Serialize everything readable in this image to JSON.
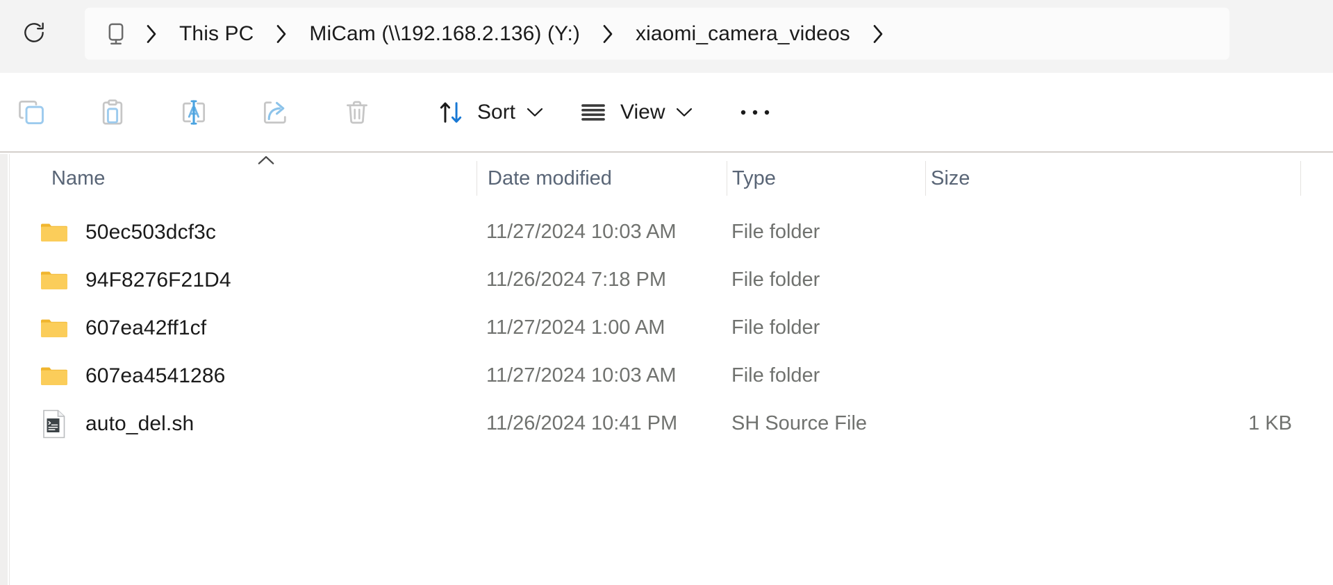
{
  "window": {
    "app": "File Explorer"
  },
  "addressbar": {
    "refresh_tooltip": "Refresh",
    "root_icon": "this-pc-icon",
    "breadcrumbs": [
      {
        "label": "This PC"
      },
      {
        "label": "MiCam (\\\\192.168.2.136) (Y:)"
      },
      {
        "label": "xiaomi_camera_videos"
      }
    ]
  },
  "toolbar": {
    "buttons": [
      {
        "name": "copy",
        "icon": "copy-icon",
        "label": "",
        "disabled": true
      },
      {
        "name": "paste",
        "icon": "paste-icon",
        "label": "",
        "disabled": true
      },
      {
        "name": "rename",
        "icon": "rename-icon",
        "label": "",
        "disabled": true
      },
      {
        "name": "share",
        "icon": "share-icon",
        "label": "",
        "disabled": true
      },
      {
        "name": "delete",
        "icon": "delete-icon",
        "label": "",
        "disabled": true
      }
    ],
    "sort_label": "Sort",
    "view_label": "View",
    "more_label": "•••"
  },
  "columns": {
    "name": "Name",
    "date_modified": "Date modified",
    "type": "Type",
    "size": "Size",
    "sorted_by": "Name",
    "sort_direction": "ascending"
  },
  "files": [
    {
      "name": "50ec503dcf3c",
      "icon": "folder-icon",
      "date_modified": "11/27/2024 10:03 AM",
      "type": "File folder",
      "size": ""
    },
    {
      "name": "94F8276F21D4",
      "icon": "folder-icon",
      "date_modified": "11/26/2024 7:18 PM",
      "type": "File folder",
      "size": ""
    },
    {
      "name": "607ea42ff1cf",
      "icon": "folder-icon",
      "date_modified": "11/27/2024 1:00 AM",
      "type": "File folder",
      "size": ""
    },
    {
      "name": "607ea4541286",
      "icon": "folder-icon",
      "date_modified": "11/27/2024 10:03 AM",
      "type": "File folder",
      "size": ""
    },
    {
      "name": "auto_del.sh",
      "icon": "script-file-icon",
      "date_modified": "11/26/2024 10:41 PM",
      "type": "SH Source File",
      "size": "1 KB"
    }
  ],
  "colors": {
    "accent_blue": "#0f6cbd",
    "disabled_icon": "#c6c6c6",
    "disabled_accent": "#a8d1f0",
    "folder_yellow": "#fbc846",
    "header_text": "#596576",
    "secondary_text": "#70726f",
    "toolbar_border": "#d4cfcb",
    "addressbar_bg": "#f3f3f3"
  }
}
